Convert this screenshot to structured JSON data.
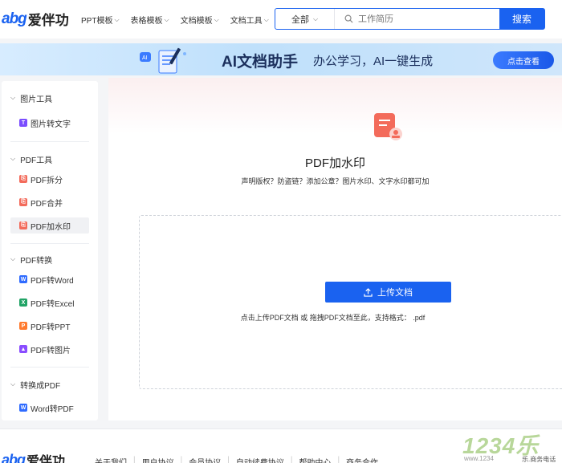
{
  "header": {
    "logo_latin": "abg",
    "logo_cn": "爱伴功",
    "nav": [
      {
        "label": "PPT模板"
      },
      {
        "label": "表格模板"
      },
      {
        "label": "文档模板"
      },
      {
        "label": "文档工具"
      }
    ],
    "search": {
      "scope": "全部",
      "placeholder": "工作简历",
      "button": "搜索"
    }
  },
  "banner": {
    "title": "AI文档助手",
    "subtitle": "办公学习，AI一键生成",
    "button": "点击查看"
  },
  "sidebar": {
    "sections": [
      {
        "title": "图片工具",
        "items": [
          {
            "label": "图片转文字",
            "badge": "T",
            "color": "#7b4dff"
          }
        ]
      },
      {
        "title": "PDF工具",
        "items": [
          {
            "label": "PDF拆分",
            "badge": "",
            "color": "#f36b5b"
          },
          {
            "label": "PDF合并",
            "badge": "",
            "color": "#f36b5b"
          },
          {
            "label": "PDF加水印",
            "badge": "",
            "color": "#f36b5b"
          }
        ]
      },
      {
        "title": "PDF转换",
        "items": [
          {
            "label": "PDF转Word",
            "badge": "W",
            "color": "#2f6bff"
          },
          {
            "label": "PDF转Excel",
            "badge": "X",
            "color": "#21a366"
          },
          {
            "label": "PDF转PPT",
            "badge": "P",
            "color": "#ff7a2e"
          },
          {
            "label": "PDF转图片",
            "badge": "",
            "color": "#8a4dff"
          }
        ]
      },
      {
        "title": "转换成PDF",
        "items": [
          {
            "label": "Word转PDF",
            "badge": "W",
            "color": "#2f6bff"
          }
        ]
      }
    ],
    "active": "PDF加水印"
  },
  "main": {
    "title": "PDF加水印",
    "description": "声明版权？防盗链？添加公章？图片水印、文字水印都可加",
    "upload_button": "上传文档",
    "upload_hint": "点击上传PDF文档 或 拖拽PDF文档至此，支持格式： .pdf"
  },
  "footer": {
    "links": [
      "关于我们",
      "用户协议",
      "会员协议",
      "自动续费协议",
      "帮助中心",
      "商务合作"
    ]
  },
  "watermark": {
    "number": "1234乐",
    "url": "www.1234",
    "tag": "乐.商务电话"
  },
  "colors": {
    "brand": "#1a62f0",
    "pdf_red": "#f36b5b"
  }
}
